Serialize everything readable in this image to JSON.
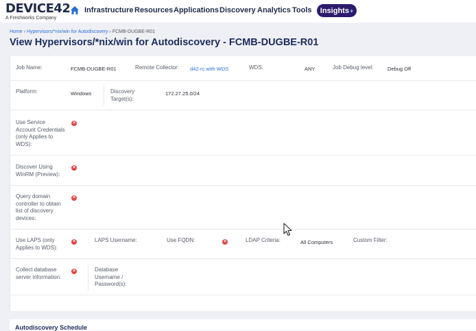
{
  "brand": {
    "logo_text": "DEVICE",
    "logo_number": "42",
    "tagline": "A Freshworks Company"
  },
  "nav": {
    "home_icon": "home-icon",
    "items": [
      "Infrastructure",
      "Resources",
      "Applications",
      "Discovery",
      "Analytics",
      "Tools"
    ],
    "insights_label": "Insights",
    "insights_plus": "+"
  },
  "breadcrumb": {
    "home": "Home",
    "sep1": "›",
    "section": "Hypervisors/*nix/win for Autodiscovery",
    "sep2": "›",
    "current": "FCMB-DUGBE-R01"
  },
  "page_title": "View Hypervisors/*nix/win for Autodiscovery - FCMB-DUGBE-R01",
  "fields": {
    "job_name_label": "Job Name:",
    "job_name_value": "FCMB-DUGBE-R01",
    "remote_collector_label": "Remote Collector:",
    "remote_collector_value": "d42-rc with WDS",
    "wds_label": "WDS:",
    "wds_value": "ANY",
    "debug_label": "Job Debug level:",
    "debug_value": "Debug Off",
    "platform_label": "Platform:",
    "platform_value": "Windows",
    "discovery_target_label": "Discovery Target(s):",
    "discovery_target_value": "172.27.25.0/24",
    "service_account_label": "Use Service Account Credentials (only Applies to WDS):",
    "winrm_label": "Discover Using WinRM (Preview):",
    "query_domain_label": "Query domain controller to obtain list of discovery devices:",
    "laps_label": "Use LAPS (only Applies to WDS):",
    "laps_username_label": "LAPS Username:",
    "fqdn_label": "Use FQDN:",
    "ldap_label": "LDAP Criteria:",
    "ldap_value": "All Computers",
    "custom_filter_label": "Custom Filter:",
    "collect_db_label": "Collect database server information:",
    "db_credentials_label": "Database Username / Password(s):"
  },
  "status_icon": "x-circle-icon",
  "status_mark": "×",
  "schedule_title": "Autodiscovery Schedule",
  "colors": {
    "accent": "#2b6fd6",
    "title": "#1c2b5a",
    "insights": "#2c1b6b",
    "no_icon": "#e04646"
  }
}
